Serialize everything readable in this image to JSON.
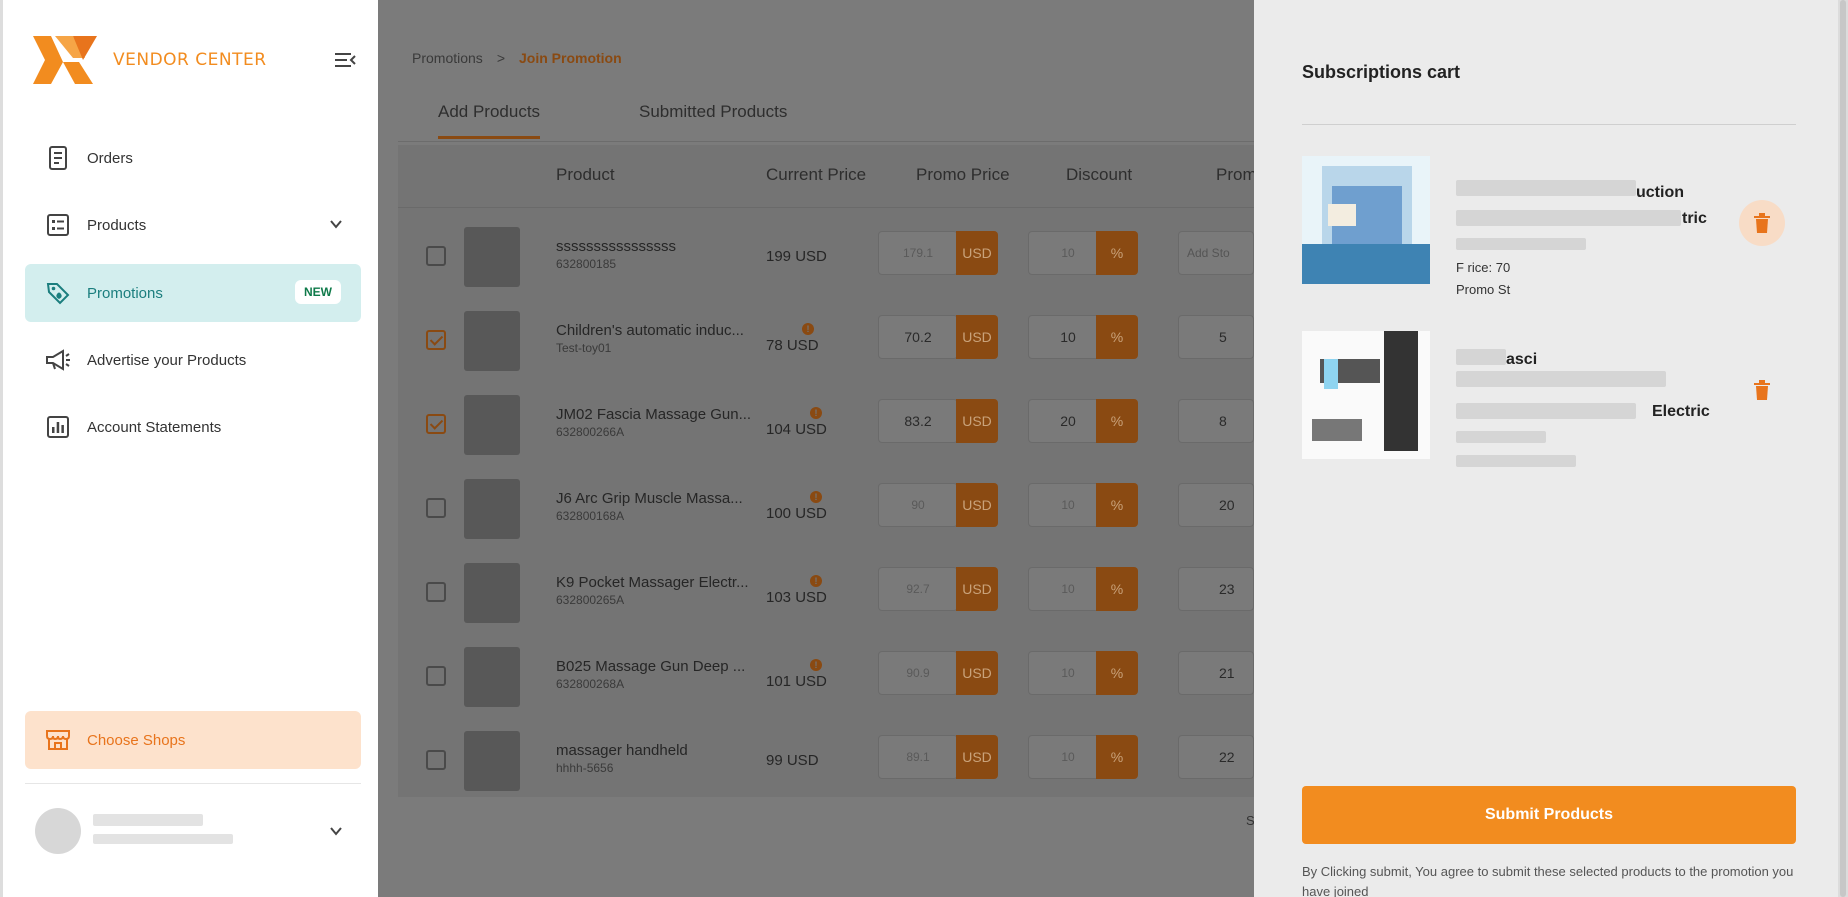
{
  "brand": {
    "name": "VENDOR CENTER",
    "accent": "#f28c1f",
    "teal": "#1b7e7e"
  },
  "sidebar": {
    "items": [
      {
        "label": "Orders",
        "icon": "receipt-icon"
      },
      {
        "label": "Products",
        "icon": "list-icon"
      },
      {
        "label": "Promotions",
        "icon": "tag-icon",
        "badge": "NEW"
      },
      {
        "label": "Advertise your Products",
        "icon": "megaphone-icon"
      },
      {
        "label": "Account Statements",
        "icon": "chart-icon"
      }
    ],
    "choose_shops": "Choose Shops"
  },
  "breadcrumb": {
    "parent": "Promotions",
    "separator": ">",
    "current": "Join Promotion"
  },
  "tabs": [
    "Add Products",
    "Submitted Products"
  ],
  "table": {
    "headers": [
      "Product",
      "Current Price",
      "Promo Price",
      "Discount",
      "Promo"
    ],
    "currency": "USD",
    "percent": "%",
    "stock_placeholder": "Add Sto",
    "rows": [
      {
        "name": "ssssssssssssssss",
        "sku": "632800185",
        "price": "199 USD",
        "promo": "179.1",
        "discount": "10",
        "stock": "",
        "checked": false,
        "info": false
      },
      {
        "name": "Children's automatic induc...",
        "sku": "Test-toy01",
        "price": "78 USD",
        "promo": "70.2",
        "discount": "10",
        "stock": "5",
        "checked": true,
        "info": true
      },
      {
        "name": "JM02 Fascia Massage Gun...",
        "sku": "632800266A",
        "price": "104 USD",
        "promo": "83.2",
        "discount": "20",
        "stock": "8",
        "checked": true,
        "info": true
      },
      {
        "name": "J6 Arc Grip Muscle Massa...",
        "sku": "632800168A",
        "price": "100 USD",
        "promo": "90",
        "discount": "10",
        "stock": "20",
        "checked": false,
        "info": true
      },
      {
        "name": "K9 Pocket Massager Electr...",
        "sku": "632800265A",
        "price": "103 USD",
        "promo": "92.7",
        "discount": "10",
        "stock": "23",
        "checked": false,
        "info": true
      },
      {
        "name": "B025 Massage Gun Deep ...",
        "sku": "632800268A",
        "price": "101 USD",
        "promo": "90.9",
        "discount": "10",
        "stock": "21",
        "checked": false,
        "info": true
      },
      {
        "name": "massager handheld",
        "sku": "hhhh-5656",
        "price": "99 USD",
        "promo": "89.1",
        "discount": "10",
        "stock": "22",
        "checked": false,
        "info": false
      }
    ],
    "footer_fragment": "S"
  },
  "cart": {
    "title": "Subscriptions cart",
    "items": [
      {
        "name_tail1": "uction",
        "name_tail2": "tric",
        "meta1": "F   rice: 70",
        "meta2": "Promo St"
      },
      {
        "name_head": "asci",
        "name_tail": "Electric"
      }
    ],
    "submit": "Submit Products",
    "disclaimer": "By Clicking submit, You agree to submit these selected products to the promotion you have joined"
  }
}
